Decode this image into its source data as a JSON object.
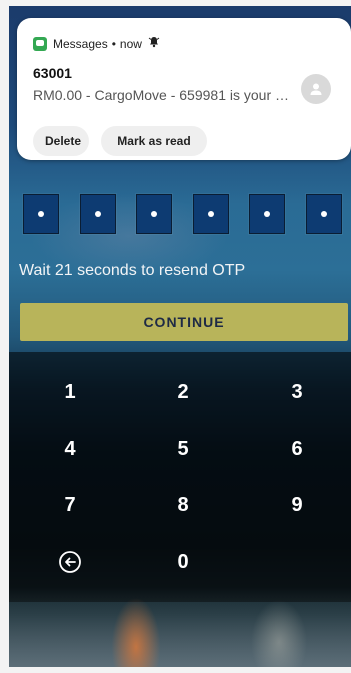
{
  "notification": {
    "app_name": "Messages",
    "separator": "•",
    "time": "now",
    "sender": "63001",
    "preview": "RM0.00 - CargoMove - 659981 is your ver...",
    "actions": [
      "Delete",
      "Mark as read"
    ]
  },
  "otp": {
    "slot_count": 6,
    "resend_text": "Wait 21 seconds to resend OTP"
  },
  "continue_label": "CONTINUE",
  "keypad": {
    "keys": [
      "1",
      "2",
      "3",
      "4",
      "5",
      "6",
      "7",
      "8",
      "9",
      "",
      "0",
      ""
    ]
  },
  "colors": {
    "continue_button": "#b8b45a",
    "otp_box": "#0d3b72",
    "app_icon": "#34a853"
  }
}
